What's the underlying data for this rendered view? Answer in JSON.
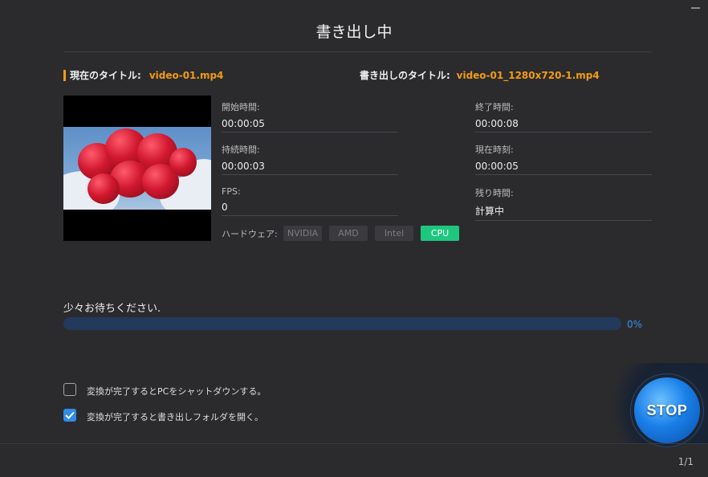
{
  "dialog": {
    "title": "書き出し中"
  },
  "current": {
    "label": "現在のタイトル:",
    "value": "video-01.mp4"
  },
  "output": {
    "label": "書き出しのタイトル:",
    "value": "video-01_1280x720-1.mp4"
  },
  "fields": {
    "start_time": {
      "label": "開始時間:",
      "value": "00:00:05"
    },
    "end_time": {
      "label": "終了時間:",
      "value": "00:00:08"
    },
    "duration": {
      "label": "持続時間:",
      "value": "00:00:03"
    },
    "current_time": {
      "label": "現在時刻:",
      "value": "00:00:05"
    },
    "fps": {
      "label": "FPS:",
      "value": "0"
    },
    "remaining": {
      "label": "残り時間:",
      "value": "計算中"
    }
  },
  "hardware": {
    "label": "ハードウェア:",
    "options": [
      "NVIDIA",
      "AMD",
      "Intel",
      "CPU"
    ],
    "active": "CPU"
  },
  "progress": {
    "message": "少々お待ちください.",
    "percent_text": "0%",
    "fraction": 0.0
  },
  "options": {
    "shutdown": {
      "label": "変換が完了するとPCをシャットダウンする。",
      "checked": false
    },
    "open_folder": {
      "label": "変換が完了すると書き出しフォルダを開く。",
      "checked": true
    }
  },
  "stop_button": {
    "label": "STOP"
  },
  "pager": {
    "text": "1/1"
  },
  "colors": {
    "accent": "#f39c12",
    "progress": "#2e6fd6",
    "active_hw": "#1ec77e",
    "checkbox": "#2f8ce8"
  }
}
